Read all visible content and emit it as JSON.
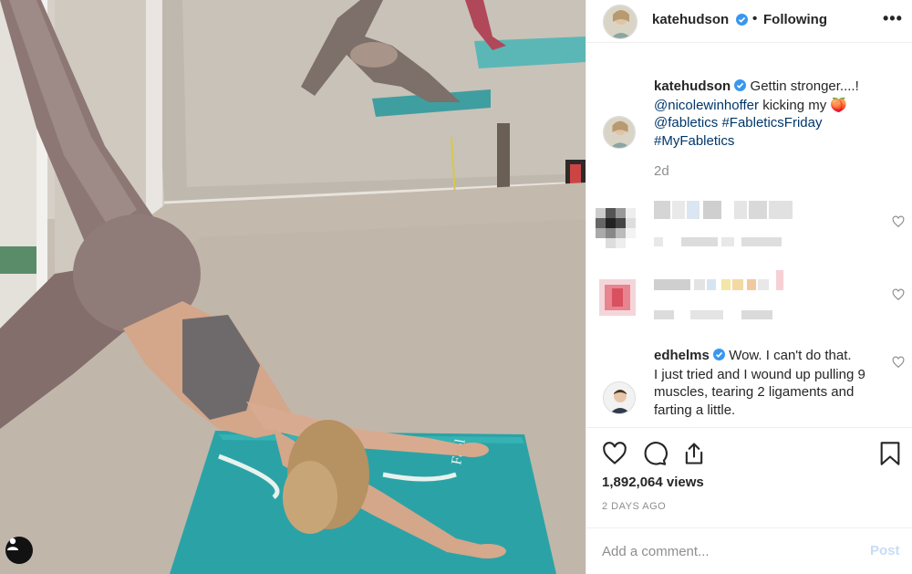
{
  "post": {
    "author": "katehudson",
    "follow_status": "Following",
    "media_alt": "Woman doing a three-legged downward dog on a teal yoga mat"
  },
  "caption": {
    "username": "katehudson",
    "text_1": "Gettin stronger....!",
    "mention_1": "@nicolewinhoffer",
    "text_2": "kicking my",
    "emoji": "🍑",
    "mention_2": "@fabletics",
    "hashtag_1": "#FableticsFriday",
    "hashtag_2": "#MyFabletics",
    "time": "2d"
  },
  "comments": [
    {
      "username": "edhelms",
      "text_1": "Wow. I can't do that.",
      "text_2": "I just tried and I wound up pulling 9",
      "text_3": "muscles, tearing 2 ligaments and",
      "text_4": "farting a little."
    }
  ],
  "stats": {
    "views": "1,892,064 views",
    "ago": "2 DAYS AGO"
  },
  "add_comment": {
    "placeholder": "Add a comment...",
    "post_label": "Post"
  },
  "colors": {
    "link": "#00376b",
    "verified": "#3897f0",
    "post_disabled": "#c7dcf7",
    "mat": "#2ba3a6"
  },
  "icons": [
    "user-tag-icon",
    "verified-badge-icon",
    "more-options-icon",
    "heart-icon",
    "comment-icon",
    "share-icon",
    "bookmark-icon"
  ]
}
